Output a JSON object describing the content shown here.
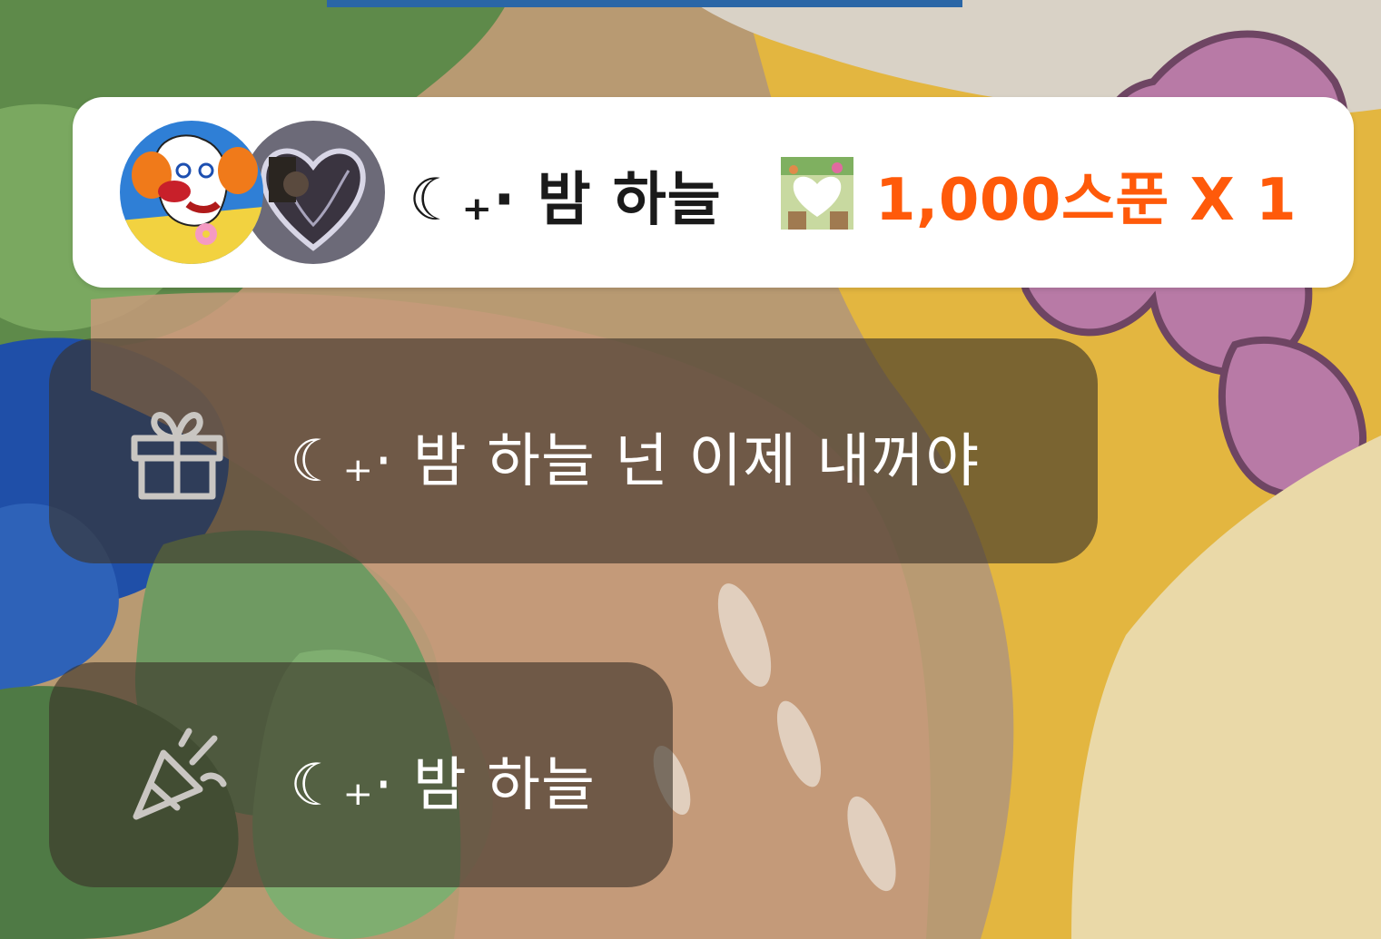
{
  "gift_banner": {
    "sender_name": "☾₊· 밤 하늘",
    "amount_text": "1,000스푼 X 1",
    "sender_avatar_icon": "clown-avatar",
    "receiver_avatar_icon": "heart-photo-avatar",
    "gift_icon": "heart-tree-sticker-icon"
  },
  "messages": [
    {
      "icon": "gift-box-icon",
      "text": "☾₊· 밤 하늘 넌 이제 내꺼야"
    },
    {
      "icon": "party-popper-icon",
      "text": "☾₊· 밤 하늘"
    }
  ],
  "colors": {
    "amount": "#ff5a0a",
    "banner_bg": "#ffffff",
    "bubble_bg": "rgba(58,50,40,0.62)",
    "bubble_text": "#ffffff"
  }
}
